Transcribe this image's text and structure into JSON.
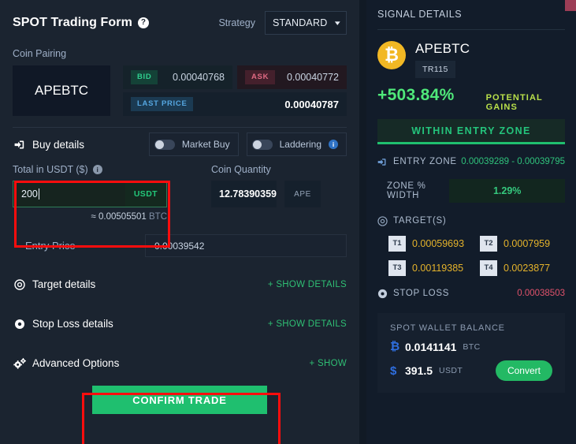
{
  "form": {
    "title": "SPOT Trading Form",
    "help_icon": "question-mark-icon",
    "strategy_label": "Strategy",
    "strategy_value": "STANDARD",
    "coin_pairing_label": "Coin Pairing",
    "pair": "APEBTC",
    "bid_tag": "BID",
    "bid_value": "0.00040768",
    "ask_tag": "ASK",
    "ask_value": "0.00040772",
    "last_tag": "LAST PRICE",
    "last_value": "0.00040787"
  },
  "buy": {
    "title": "Buy details",
    "market_buy_label": "Market Buy",
    "laddering_label": "Laddering",
    "total_label": "Total in USDT ($)",
    "total_value": "200",
    "total_unit": "USDT",
    "approx_symbol": "≈",
    "approx_value": "0.00505501",
    "approx_unit": "BTC",
    "quantity_label": "Coin Quantity",
    "quantity_value": "12.78390359",
    "quantity_unit": "APE",
    "entry_price_label": "Entry Price",
    "entry_price_value": "0.00039542"
  },
  "sections": {
    "target_details": "Target details",
    "target_show": "+ SHOW DETAILS",
    "stop_loss_details": "Stop Loss details",
    "stop_loss_show": "+ SHOW DETAILS",
    "advanced_options": "Advanced Options",
    "advanced_show": "+ SHOW"
  },
  "confirm_button": "CONFIRM TRADE",
  "signal": {
    "panel_title": "SIGNAL DETAILS",
    "coin": "APEBTC",
    "badge": "TR115",
    "gain_pct": "+503.84%",
    "gain_label": "POTENTIAL GAINS",
    "status": "WITHIN ENTRY ZONE",
    "entry_zone_label": "ENTRY ZONE",
    "entry_zone_value": "0.00039289 - 0.00039795",
    "zone_width_label": "ZONE % WIDTH",
    "zone_width_value": "1.29%",
    "targets_label": "TARGET(S)",
    "targets": [
      {
        "id": "T1",
        "value": "0.00059693"
      },
      {
        "id": "T2",
        "value": "0.0007959"
      },
      {
        "id": "T3",
        "value": "0.00119385"
      },
      {
        "id": "T4",
        "value": "0.0023877"
      }
    ],
    "stop_loss_label": "STOP LOSS",
    "stop_loss_value": "0.00038503"
  },
  "wallet": {
    "title": "SPOT WALLET BALANCE",
    "btc_symbol": "₿",
    "btc_amount": "0.0141141",
    "btc_unit": "BTC",
    "usdt_symbol": "$",
    "usdt_amount": "391.5",
    "usdt_unit": "USDT",
    "convert_label": "Convert"
  },
  "colors": {
    "accent_green": "#1fbf6f",
    "annotation_red": "#fd0d0d",
    "target_yellow": "#e5b32b",
    "stop_loss_red": "#e0526b",
    "coin_badge_gold": "#f2b824"
  }
}
